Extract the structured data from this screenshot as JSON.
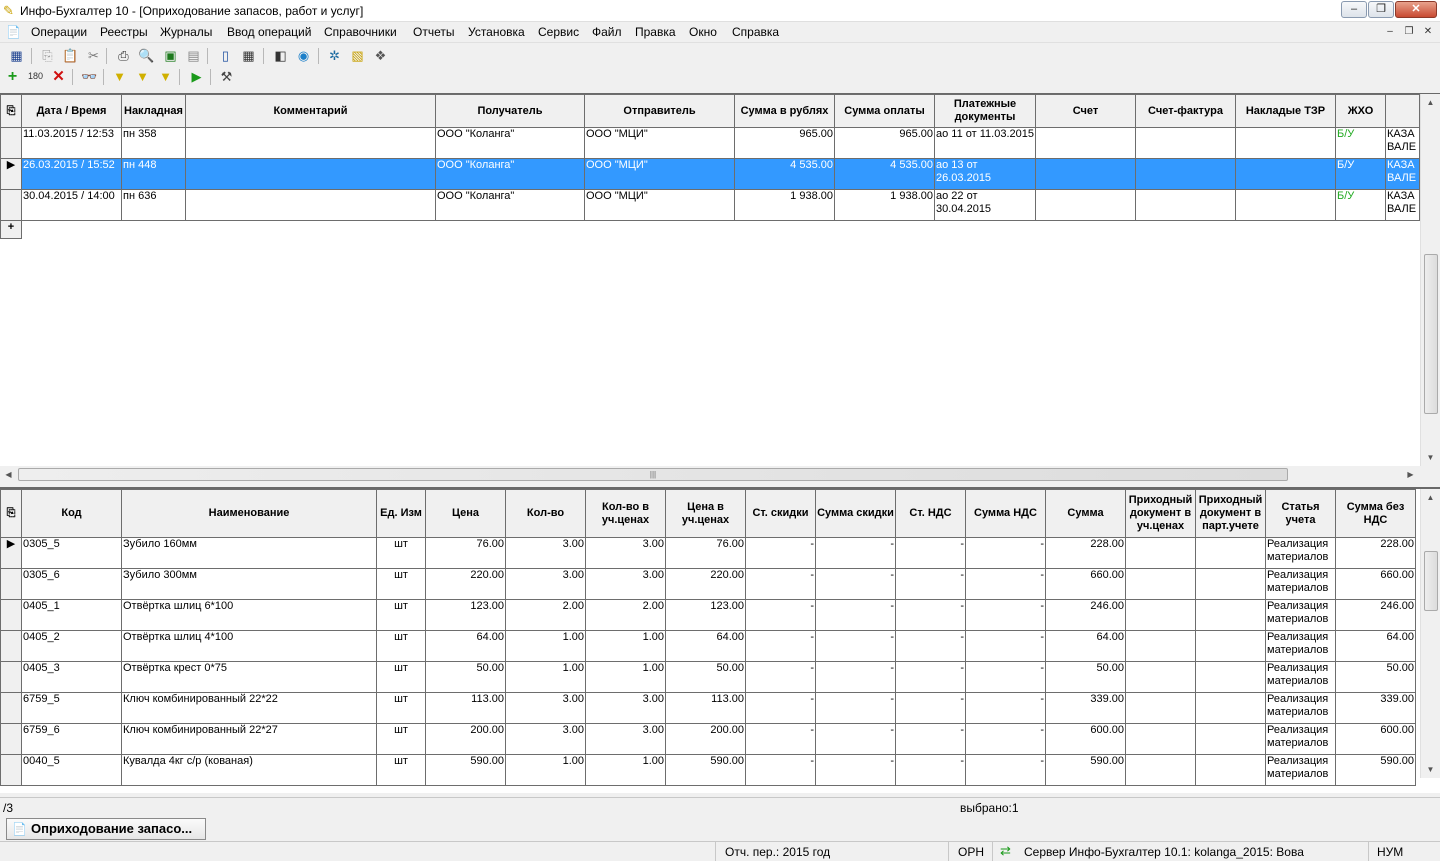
{
  "window": {
    "title": "Инфо-Бухгалтер 10 - [Оприходование запасов, работ и услуг]"
  },
  "menu": [
    "Операции",
    "Реестры",
    "Журналы",
    "Ввод операций",
    "Справочники",
    "Отчеты",
    "Установка",
    "Сервис",
    "Файл",
    "Правка",
    "Окно",
    "Справка"
  ],
  "invoices": {
    "columns": [
      "Дата / Время",
      "Накладная",
      "Комментарий",
      "Получатель",
      "Отправитель",
      "Сумма в рублях",
      "Сумма оплаты",
      "Платежные документы",
      "Счет",
      "Счет-фактура",
      "Накладые ТЗР",
      "ЖХО",
      ""
    ],
    "rows": [
      {
        "date": "11.03.2015 / 12:53",
        "number": "пн 358",
        "comment": "",
        "recipient": "ООО \"Коланга\"",
        "sender": "ООО \"МЦИ\"",
        "sum": "965.00",
        "paid": "965.00",
        "payment_docs": "ао 11 от 11.03.2015",
        "account": "",
        "invoice": "",
        "tzr": "",
        "zho": "Б/У",
        "extra": "КАЗА ВАЛЕ"
      },
      {
        "date": "26.03.2015 / 15:52",
        "number": "пн 448",
        "comment": "",
        "recipient": "ООО \"Коланга\"",
        "sender": "ООО \"МЦИ\"",
        "sum": "4 535.00",
        "paid": "4 535.00",
        "payment_docs": "ао 13 от 26.03.2015",
        "account": "",
        "invoice": "",
        "tzr": "",
        "zho": "Б/У",
        "extra": "КАЗА ВАЛЕ"
      },
      {
        "date": "30.04.2015 / 14:00",
        "number": "пн 636",
        "comment": "",
        "recipient": "ООО \"Коланга\"",
        "sender": "ООО \"МЦИ\"",
        "sum": "1 938.00",
        "paid": "1 938.00",
        "payment_docs": "ао 22 от 30.04.2015",
        "account": "",
        "invoice": "",
        "tzr": "",
        "zho": "Б/У",
        "extra": "КАЗА ВАЛЕ"
      }
    ],
    "selected_row": 1,
    "new_row_marker": "+"
  },
  "items": {
    "columns": [
      "Код",
      "Наименование",
      "Ед. Изм",
      "Цена",
      "Кол-во",
      "Кол-во в уч.ценах",
      "Цена в уч.ценах",
      "Ст. скидки",
      "Сумма скидки",
      "Ст. НДС",
      "Сумма НДС",
      "Сумма",
      "Приходный документ в уч.ценах",
      "Приходный документ в парт.учете",
      "Статья учета",
      "Сумма без НДС"
    ],
    "rows": [
      {
        "code": "0305_5",
        "name": "Зубило 160мм",
        "unit": "шт",
        "price": "76.00",
        "qty": "3.00",
        "qty_acc": "3.00",
        "price_acc": "76.00",
        "disc_rate": "-",
        "disc_sum": "-",
        "vat_rate": "-",
        "vat_sum": "-",
        "sum": "228.00",
        "doc_acc": "",
        "doc_part": "",
        "article": "Реализация материалов",
        "sum_no_vat": "228.00"
      },
      {
        "code": "0305_6",
        "name": "Зубило 300мм",
        "unit": "шт",
        "price": "220.00",
        "qty": "3.00",
        "qty_acc": "3.00",
        "price_acc": "220.00",
        "disc_rate": "-",
        "disc_sum": "-",
        "vat_rate": "-",
        "vat_sum": "-",
        "sum": "660.00",
        "doc_acc": "",
        "doc_part": "",
        "article": "Реализация материалов",
        "sum_no_vat": "660.00"
      },
      {
        "code": "0405_1",
        "name": "Отвёртка шлиц 6*100",
        "unit": "шт",
        "price": "123.00",
        "qty": "2.00",
        "qty_acc": "2.00",
        "price_acc": "123.00",
        "disc_rate": "-",
        "disc_sum": "-",
        "vat_rate": "-",
        "vat_sum": "-",
        "sum": "246.00",
        "doc_acc": "",
        "doc_part": "",
        "article": "Реализация материалов",
        "sum_no_vat": "246.00"
      },
      {
        "code": "0405_2",
        "name": "Отвёртка шлиц 4*100",
        "unit": "шт",
        "price": "64.00",
        "qty": "1.00",
        "qty_acc": "1.00",
        "price_acc": "64.00",
        "disc_rate": "-",
        "disc_sum": "-",
        "vat_rate": "-",
        "vat_sum": "-",
        "sum": "64.00",
        "doc_acc": "",
        "doc_part": "",
        "article": "Реализация материалов",
        "sum_no_vat": "64.00"
      },
      {
        "code": "0405_3",
        "name": "Отвёртка крест 0*75",
        "unit": "шт",
        "price": "50.00",
        "qty": "1.00",
        "qty_acc": "1.00",
        "price_acc": "50.00",
        "disc_rate": "-",
        "disc_sum": "-",
        "vat_rate": "-",
        "vat_sum": "-",
        "sum": "50.00",
        "doc_acc": "",
        "doc_part": "",
        "article": "Реализация материалов",
        "sum_no_vat": "50.00"
      },
      {
        "code": "6759_5",
        "name": "Ключ комбинированный 22*22",
        "unit": "шт",
        "price": "113.00",
        "qty": "3.00",
        "qty_acc": "3.00",
        "price_acc": "113.00",
        "disc_rate": "-",
        "disc_sum": "-",
        "vat_rate": "-",
        "vat_sum": "-",
        "sum": "339.00",
        "doc_acc": "",
        "doc_part": "",
        "article": "Реализация материалов",
        "sum_no_vat": "339.00"
      },
      {
        "code": "6759_6",
        "name": "Ключ комбинированный 22*27",
        "unit": "шт",
        "price": "200.00",
        "qty": "3.00",
        "qty_acc": "3.00",
        "price_acc": "200.00",
        "disc_rate": "-",
        "disc_sum": "-",
        "vat_rate": "-",
        "vat_sum": "-",
        "sum": "600.00",
        "doc_acc": "",
        "doc_part": "",
        "article": "Реализация материалов",
        "sum_no_vat": "600.00"
      },
      {
        "code": "0040_5",
        "name": "Кувалда 4кг с/р (кованая)",
        "unit": "шт",
        "price": "590.00",
        "qty": "1.00",
        "qty_acc": "1.00",
        "price_acc": "590.00",
        "disc_rate": "-",
        "disc_sum": "-",
        "vat_rate": "-",
        "vat_sum": "-",
        "sum": "590.00",
        "doc_acc": "",
        "doc_part": "",
        "article": "Реализация материалов",
        "sum_no_vat": "590.00"
      }
    ],
    "selected_row": 0
  },
  "status": {
    "record_pos": "/3",
    "selected": "выбрано:1",
    "period": "Отч. пер.: 2015 год",
    "orn": "ОРН",
    "server": "Сервер Инфо-Бухгалтер 10.1: kolanga_2015: Вова",
    "num": "НУМ"
  },
  "tab": {
    "label": "Оприходование запасо..."
  },
  "colors": {
    "selection": "#3399ff",
    "zho_green": "#22aa22"
  }
}
